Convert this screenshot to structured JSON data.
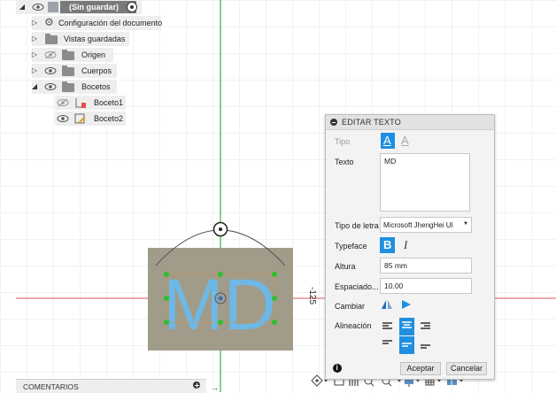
{
  "browser": {
    "root_label": "(Sin guardar)",
    "items": [
      {
        "label": "Configuración del documento"
      },
      {
        "label": "Vistas guardadas"
      },
      {
        "label": "Origen"
      },
      {
        "label": "Cuerpos"
      },
      {
        "label": "Bocetos"
      },
      {
        "label": "Boceto1"
      },
      {
        "label": "Boceto2"
      }
    ]
  },
  "canvas": {
    "sketch_text": "MD",
    "dimension_label": "-125"
  },
  "dialog": {
    "title": "EDITAR TEXTO",
    "tipo_label": "Tipo",
    "texto_label": "Texto",
    "texto_value": "MD",
    "font_label": "Tipo de letra",
    "font_value": "Microsoft JhengHei UI",
    "typeface_label": "Typeface",
    "bold_glyph": "B",
    "italic_glyph": "I",
    "altura_label": "Altura",
    "altura_value": "85 mm",
    "espaciado_label": "Espaciado...",
    "espaciado_value": "10.00",
    "cambiar_label": "Cambiar",
    "alineacion_label": "Alineación",
    "info_glyph": "i",
    "accept_label": "Aceptar",
    "cancel_label": "Cancelar",
    "type_glyph": "A"
  },
  "comments": {
    "label": "COMENTARIOS"
  },
  "colors": {
    "accent": "#1f8fe0",
    "sketch_fill": "#6db8e6",
    "sketch_plate": "#a19c8a",
    "axis_green": "#3db03d",
    "axis_red": "#e05050"
  }
}
